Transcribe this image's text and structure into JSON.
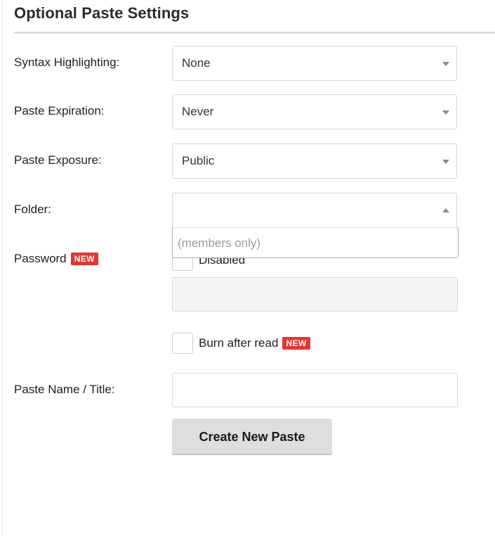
{
  "section": {
    "title": "Optional Paste Settings"
  },
  "fields": {
    "syntax": {
      "label": "Syntax Highlighting:",
      "value": "None"
    },
    "expiration": {
      "label": "Paste Expiration:",
      "value": "Never"
    },
    "exposure": {
      "label": "Paste Exposure:",
      "value": "Public"
    },
    "folder": {
      "label": "Folder:",
      "value": "",
      "dropdown_options": [
        "(members only)"
      ]
    },
    "password": {
      "label": "Password",
      "badge": "NEW",
      "checkbox_label": "Disabled",
      "input_value": ""
    },
    "burn": {
      "label": "Burn after read",
      "badge": "NEW"
    },
    "title": {
      "label": "Paste Name / Title:",
      "value": ""
    }
  },
  "actions": {
    "create_label": "Create New Paste"
  },
  "colors": {
    "badge": "#e3362f",
    "button_bg": "#dedede"
  },
  "icons": {
    "select_caret": "caret-down-icon",
    "select_caret_open": "caret-up-icon"
  }
}
